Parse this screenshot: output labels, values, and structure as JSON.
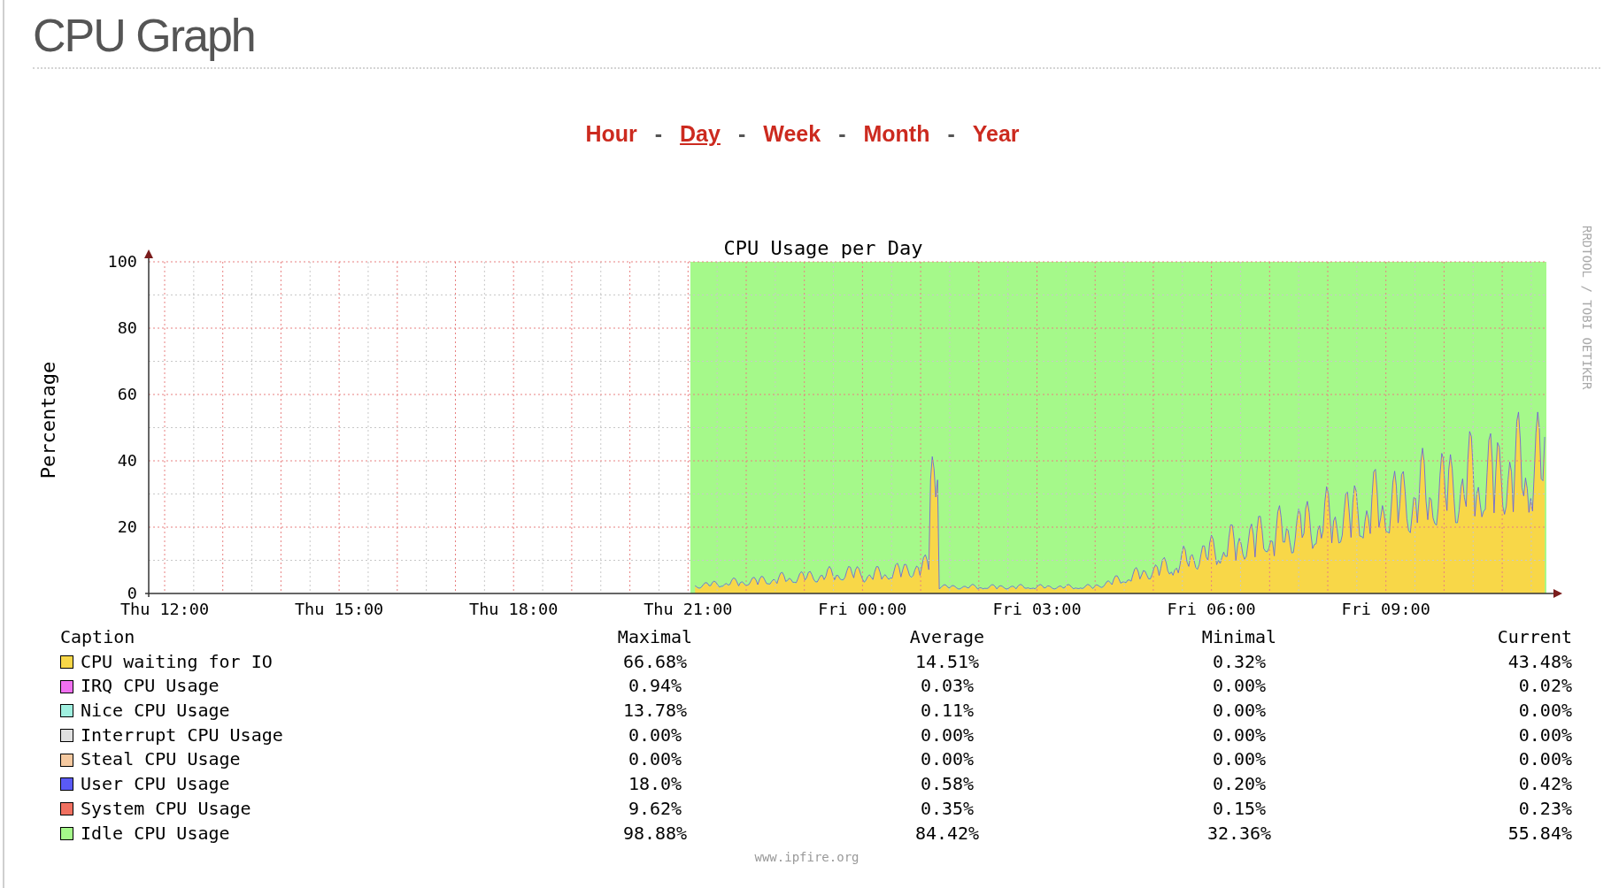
{
  "page": {
    "title": "CPU Graph"
  },
  "nav": {
    "links": [
      {
        "label": "Hour",
        "selected": false
      },
      {
        "label": "Day",
        "selected": true
      },
      {
        "label": "Week",
        "selected": false
      },
      {
        "label": "Month",
        "selected": false
      },
      {
        "label": "Year",
        "selected": false
      }
    ],
    "separators": [
      "-",
      "-",
      "-",
      "-"
    ]
  },
  "graph": {
    "title": "CPU Usage per Day",
    "y_label": "Percentage",
    "y_ticks": [
      "100",
      "80",
      "60",
      "40",
      "20",
      "0"
    ],
    "x_ticks": [
      "Thu 12:00",
      "Thu 15:00",
      "Thu 18:00",
      "Thu 21:00",
      "Fri 00:00",
      "Fri 03:00",
      "Fri 06:00",
      "Fri 09:00"
    ],
    "credit": "RRDTOOL / TOBI OETIKER"
  },
  "legend": {
    "columns": [
      "Caption",
      "Maximal",
      "Average",
      "Minimal",
      "Current"
    ],
    "rows": [
      {
        "name": "CPU waiting for IO",
        "color": "#f8d748",
        "max": "66.68%",
        "avg": "14.51%",
        "min": "0.32%",
        "cur": "43.48%"
      },
      {
        "name": "IRQ CPU Usage",
        "color": "#f070f0",
        "max": "0.94%",
        "avg": "0.03%",
        "min": "0.00%",
        "cur": "0.02%"
      },
      {
        "name": "Nice CPU Usage",
        "color": "#a0f0e0",
        "max": "13.78%",
        "avg": "0.11%",
        "min": "0.00%",
        "cur": "0.00%"
      },
      {
        "name": "Interrupt CPU Usage",
        "color": "#e0e0e0",
        "max": "0.00%",
        "avg": "0.00%",
        "min": "0.00%",
        "cur": "0.00%"
      },
      {
        "name": "Steal CPU Usage",
        "color": "#f5c9a0",
        "max": "0.00%",
        "avg": "0.00%",
        "min": "0.00%",
        "cur": "0.00%"
      },
      {
        "name": "User CPU Usage",
        "color": "#5a5af5",
        "max": "18.0%",
        "avg": "0.58%",
        "min": "0.20%",
        "cur": "0.42%"
      },
      {
        "name": "System CPU Usage",
        "color": "#f07060",
        "max": "9.62%",
        "avg": "0.35%",
        "min": "0.15%",
        "cur": "0.23%"
      },
      {
        "name": "Idle CPU Usage",
        "color": "#a5f98a",
        "max": "98.88%",
        "avg": "84.42%",
        "min": "32.36%",
        "cur": "55.84%"
      }
    ]
  },
  "footer": {
    "text": "www.ipfire.org"
  }
}
